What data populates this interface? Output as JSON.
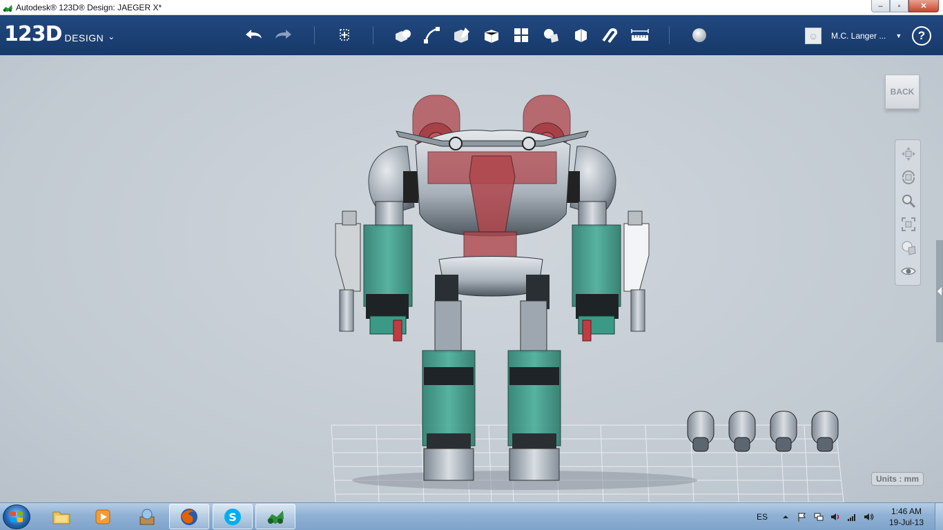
{
  "window": {
    "title": "Autodesk® 123D® Design: JAEGER X*",
    "controls": {
      "minimize": "‒",
      "maximize": "▫",
      "close": "✕"
    }
  },
  "brand": {
    "logo": "123D",
    "sub": "DESIGN",
    "chevron": "⌄"
  },
  "toolbar": {
    "tools": [
      "undo-icon",
      "redo-icon",
      "transform-icon",
      "primitives-icon",
      "sketch-icon",
      "construct-icon",
      "modify-icon",
      "pattern-icon",
      "grouping-icon",
      "combine-icon",
      "snap-icon",
      "measure-icon",
      "material-icon"
    ]
  },
  "user": {
    "name": "M.C. Langer ...",
    "caret": "▼"
  },
  "help": {
    "label": "?"
  },
  "viewcube": {
    "face": "BACK"
  },
  "navbar": {
    "tools": [
      "pan-icon",
      "orbit-icon",
      "zoom-icon",
      "fit-icon",
      "view-style-icon",
      "visibility-icon"
    ]
  },
  "units": {
    "label": "Units : mm"
  },
  "colors": {
    "toolbar": "#1a3f73",
    "viewport": "#c4ccd4",
    "teal_part": "#3a9a86",
    "red_part": "#b0474d",
    "metal_part": "#a7b0b9"
  },
  "taskbar": {
    "apps": [
      "windows-explorer-icon",
      "media-player-icon",
      "archive-icon",
      "firefox-icon",
      "skype-icon",
      "123d-app-icon"
    ],
    "tray": {
      "language": "ES"
    },
    "clock": {
      "time": "1:46 AM",
      "date": "19-Jul-13"
    }
  }
}
